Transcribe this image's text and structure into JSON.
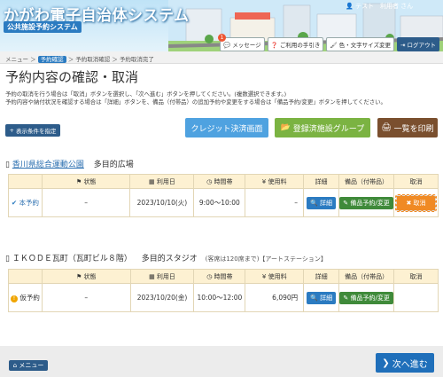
{
  "header": {
    "title": "かがわ電子自治体システム",
    "subtitle": "公共施設予約システム",
    "user": "テスト　利用者 さん",
    "buttons": {
      "message": "メッセージ",
      "message_count": "1",
      "guide": "ご利用の手引き",
      "color": "色・文字サイズ変更",
      "logout": "ログアウト"
    }
  },
  "breadcrumb": {
    "menu": "メニュー",
    "current": "予約確認",
    "step2": "予約取消確認",
    "step3": "予約取消完了"
  },
  "page": {
    "title": "予約内容の確認・取消",
    "desc1": "予約の取消を行う場合は「取消」ボタンを選択し、「次へ進む」ボタンを押してください。(複数選択できます。)",
    "desc2": "予約内容や納付状況を確認する場合は「詳細」ボタンを、備品（付帯品）の追加予約や変更をする場合は「備品予約/変更」ボタンを押してください。"
  },
  "actions": {
    "filter": "表示条件を指定",
    "credit": "クレジット決済画面",
    "group": "登録済施設グループ",
    "print": "一覧を印刷"
  },
  "columns": {
    "status": "状態",
    "date": "利用日",
    "time": "時間帯",
    "fee": "使用料",
    "detail": "詳細",
    "equip": "備品（付帯品）",
    "cancel": "取消"
  },
  "facilities": [
    {
      "name": "香川県総合運動公園",
      "room": "多目的広場",
      "note": "",
      "row": {
        "status": "本予約",
        "dash": "–",
        "date": "2023/10/10(火)",
        "time": "9:00～10:00",
        "fee": "–",
        "detail": "詳細",
        "equip": "備品予約/変更",
        "cancel": "取消"
      }
    },
    {
      "name": "ＩＫＯＤＥ瓦町（瓦町ビル８階）",
      "room": "多目的スタジオ",
      "note": "(客席は120席まで)【アートステーション】",
      "row": {
        "status": "仮予約",
        "dash": "–",
        "date": "2023/10/20(金)",
        "time": "10:00～12:00",
        "fee": "6,090円",
        "detail": "詳細",
        "equip": "備品予約/変更",
        "cancel": ""
      }
    }
  ],
  "footer": {
    "menu": "メニュー",
    "next": "次へ進む"
  },
  "colors": {
    "primary": "#2b7bc1",
    "navy": "#2d5c8a",
    "green": "#7bb342",
    "brown": "#7a4f2e",
    "orange": "#f08a24",
    "table_header": "#fdf1d2"
  }
}
